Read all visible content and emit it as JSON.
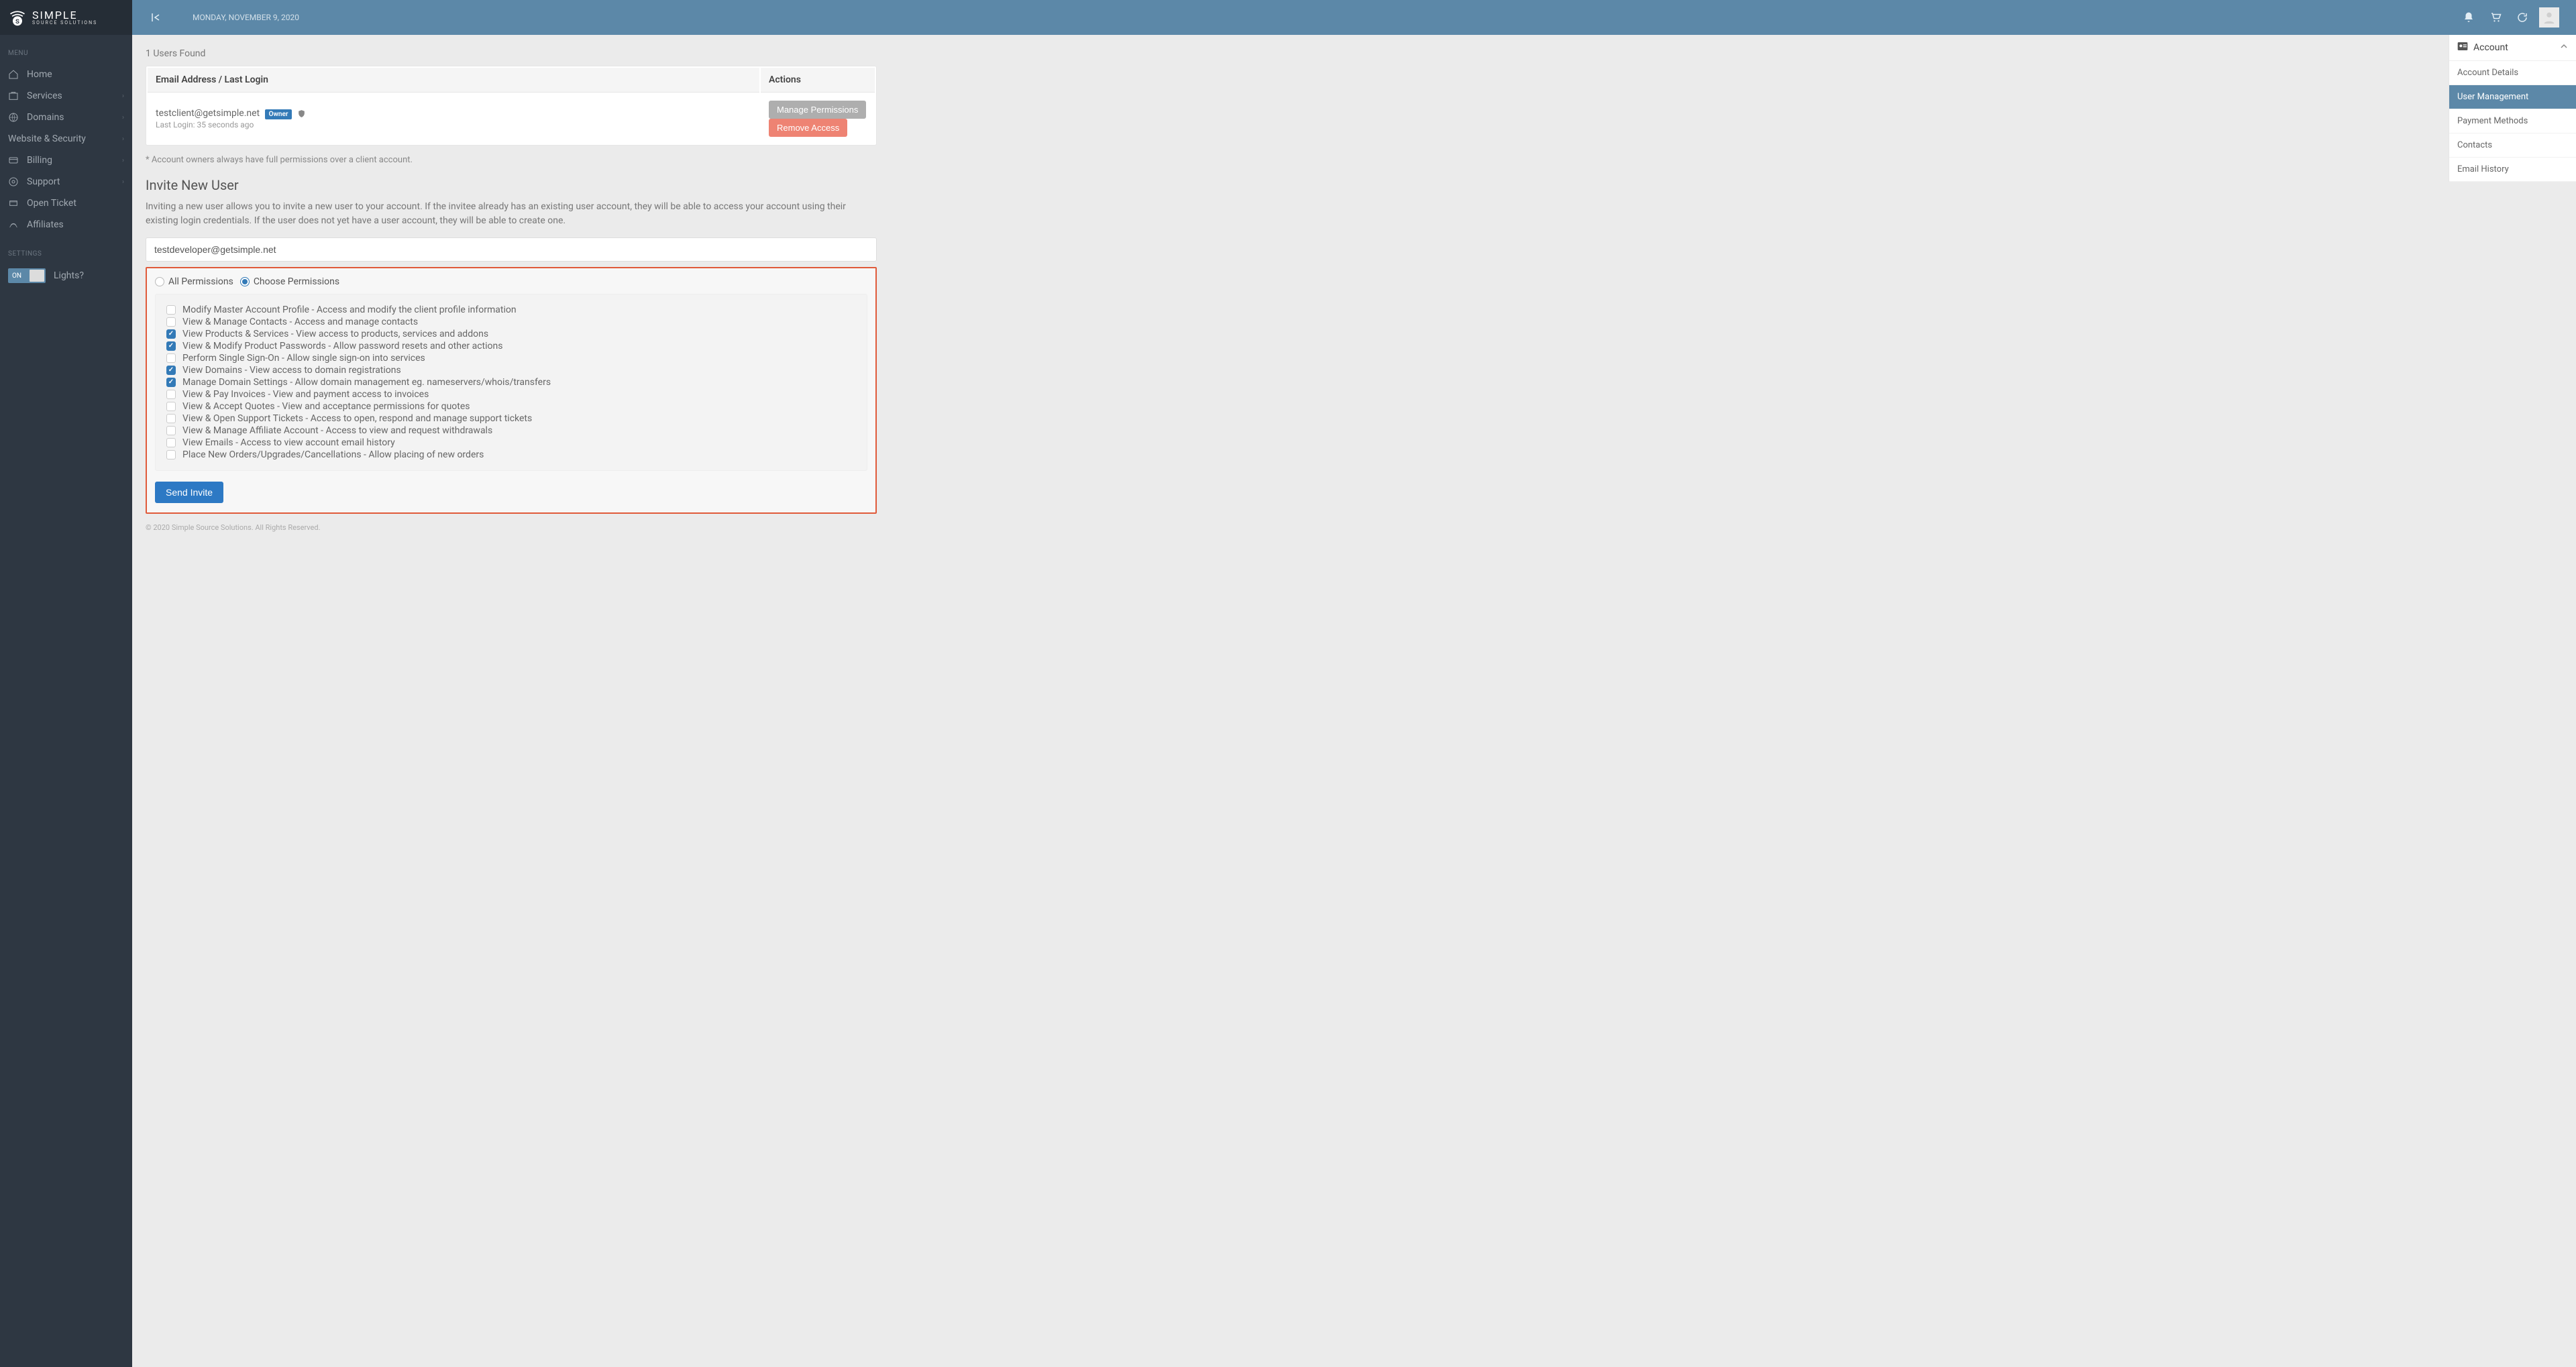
{
  "brand": {
    "main": "SIMPLE",
    "sub": "SOURCE SOLUTIONS"
  },
  "topbar": {
    "date": "MONDAY, NOVEMBER 9, 2020"
  },
  "sidebar": {
    "menu_header": "MENU",
    "items": [
      {
        "label": "Home",
        "caret": false
      },
      {
        "label": "Services",
        "caret": true
      },
      {
        "label": "Domains",
        "caret": true
      },
      {
        "label": "Website & Security",
        "caret": true
      },
      {
        "label": "Billing",
        "caret": true
      },
      {
        "label": "Support",
        "caret": true
      },
      {
        "label": "Open Ticket",
        "caret": false
      },
      {
        "label": "Affiliates",
        "caret": false
      }
    ],
    "settings_header": "SETTINGS",
    "toggle_on": "ON",
    "lights_label": "Lights?"
  },
  "main": {
    "users_found": "1 Users Found",
    "table_header_email": "Email Address / Last Login",
    "table_header_actions": "Actions",
    "row": {
      "email": "testclient@getsimple.net",
      "owner_badge": "Owner",
      "last_login": "Last Login: 35 seconds ago",
      "manage_btn": "Manage Permissions",
      "remove_btn": "Remove Access"
    },
    "footnote": "* Account owners always have full permissions over a client account.",
    "invite_heading": "Invite New User",
    "invite_desc": "Inviting a new user allows you to invite a new user to your account. If the invitee already has an existing user account, they will be able to access your account using their existing login credentials. If the user does not yet have a user account, they will be able to create one.",
    "invite_email_value": "testdeveloper@getsimple.net",
    "radio_all": "All Permissions",
    "radio_choose": "Choose Permissions",
    "permissions": [
      {
        "label": "Modify Master Account Profile - Access and modify the client profile information",
        "checked": false
      },
      {
        "label": "View & Manage Contacts - Access and manage contacts",
        "checked": false
      },
      {
        "label": "View Products & Services - View access to products, services and addons",
        "checked": true
      },
      {
        "label": "View & Modify Product Passwords - Allow password resets and other actions",
        "checked": true
      },
      {
        "label": "Perform Single Sign-On - Allow single sign-on into services",
        "checked": false
      },
      {
        "label": "View Domains - View access to domain registrations",
        "checked": true
      },
      {
        "label": "Manage Domain Settings - Allow domain management eg. nameservers/whois/transfers",
        "checked": true
      },
      {
        "label": "View & Pay Invoices - View and payment access to invoices",
        "checked": false
      },
      {
        "label": "View & Accept Quotes - View and acceptance permissions for quotes",
        "checked": false
      },
      {
        "label": "View & Open Support Tickets - Access to open, respond and manage support tickets",
        "checked": false
      },
      {
        "label": "View & Manage Affiliate Account - Access to view and request withdrawals",
        "checked": false
      },
      {
        "label": "View Emails - Access to view account email history",
        "checked": false
      },
      {
        "label": "Place New Orders/Upgrades/Cancellations - Allow placing of new orders",
        "checked": false
      }
    ],
    "send_invite": "Send Invite"
  },
  "right_panel": {
    "header": "Account",
    "items": [
      {
        "label": "Account Details",
        "active": false
      },
      {
        "label": "User Management",
        "active": true
      },
      {
        "label": "Payment Methods",
        "active": false
      },
      {
        "label": "Contacts",
        "active": false
      },
      {
        "label": "Email History",
        "active": false
      }
    ]
  },
  "footer": "© 2020 Simple Source Solutions. All Rights Reserved."
}
